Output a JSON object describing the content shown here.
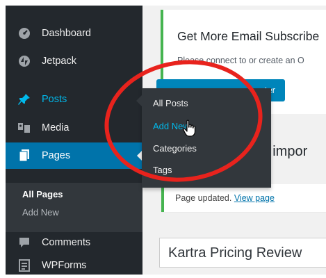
{
  "sidebar": {
    "items": [
      {
        "label": "Dashboard",
        "icon": "dashboard-icon"
      },
      {
        "label": "Jetpack",
        "icon": "jetpack-icon"
      },
      {
        "label": "Posts",
        "icon": "pin-icon"
      },
      {
        "label": "Media",
        "icon": "media-icon"
      },
      {
        "label": "Pages",
        "icon": "pages-icon"
      },
      {
        "label": "Comments",
        "icon": "comment-icon"
      },
      {
        "label": "WPForms",
        "icon": "wpforms-icon"
      }
    ],
    "pages_submenu": [
      {
        "label": "All Pages"
      },
      {
        "label": "Add New"
      }
    ]
  },
  "posts_flyout": {
    "items": [
      {
        "label": "All Posts"
      },
      {
        "label": "Add New"
      },
      {
        "label": "Categories"
      },
      {
        "label": "Tags"
      }
    ]
  },
  "main": {
    "email_notice": {
      "title": "Get More Email Subscribe",
      "text": "Please connect to or create an O",
      "button_label": "ster"
    },
    "import_text": "to impor",
    "updated_notice": {
      "text": "Page updated.",
      "link": "View page"
    },
    "post_title_value": "Kartra Pricing Review"
  },
  "colors": {
    "sidebar_bg": "#23282d",
    "active_bg": "#0073aa",
    "accent": "#00b9eb",
    "highlight_circle": "#e8231d",
    "notice_border": "#46b450"
  }
}
